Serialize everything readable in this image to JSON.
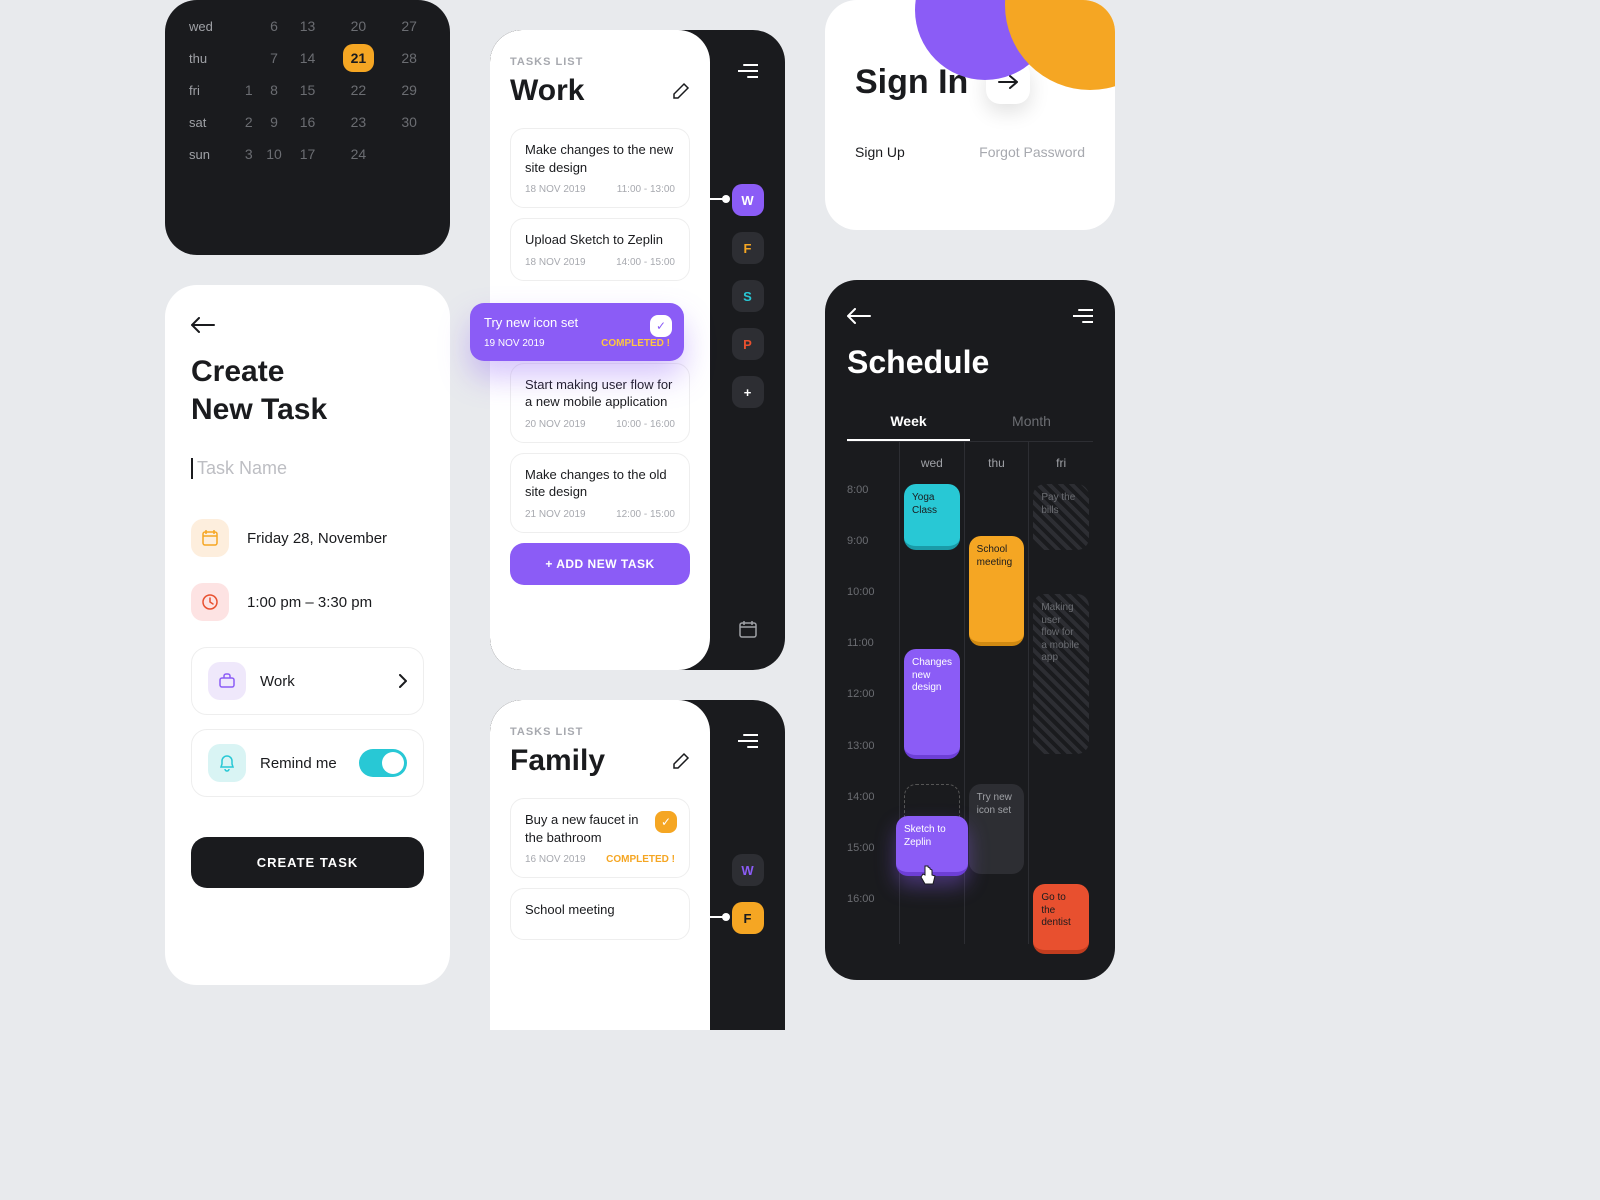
{
  "calendar": {
    "rows": [
      {
        "day": "wed",
        "cells": [
          "6",
          "13",
          "20",
          "27"
        ]
      },
      {
        "day": "thu",
        "cells": [
          "7",
          "14",
          "21",
          "28"
        ],
        "sel": 2
      },
      {
        "day": "fri",
        "cells": [
          "1",
          "8",
          "15",
          "22",
          "29"
        ]
      },
      {
        "day": "sat",
        "cells": [
          "2",
          "9",
          "16",
          "23",
          "30"
        ]
      },
      {
        "day": "sun",
        "cells": [
          "3",
          "10",
          "17",
          "24",
          ""
        ]
      }
    ]
  },
  "create": {
    "title1": "Create",
    "title2": "New Task",
    "placeholder": "Task Name",
    "date": "Friday 28, November",
    "time": "1:00 pm – 3:30 pm",
    "category": "Work",
    "remind": "Remind me",
    "button": "CREATE TASK"
  },
  "tasks1": {
    "label": "TASKS LIST",
    "title": "Work",
    "items": [
      {
        "t": "Make changes to the new site design",
        "d": "18 NOV 2019",
        "h": "11:00 - 13:00"
      },
      {
        "t": "Upload Sketch to Zeplin",
        "d": "18 NOV 2019",
        "h": "14:00 - 15:00"
      },
      {
        "t": "Start making user flow for a new mobile application",
        "d": "20 NOV 2019",
        "h": "10:00 - 16:00"
      },
      {
        "t": "Make changes to the old site design",
        "d": "21 NOV 2019",
        "h": "12:00 - 15:00"
      }
    ],
    "completed": {
      "t": "Try new icon set",
      "d": "19 NOV 2019",
      "status": "COMPLETED !"
    },
    "add": "+ ADD NEW TASK",
    "chips": [
      "W",
      "F",
      "S",
      "P",
      "+"
    ]
  },
  "tasks2": {
    "label": "TASKS LIST",
    "title": "Family",
    "item": {
      "t": "Buy a new faucet in the bathroom",
      "d": "16 NOV 2019",
      "status": "COMPLETED !"
    },
    "item2": "School meeting",
    "chips": [
      "W",
      "F"
    ]
  },
  "signin": {
    "title": "Sign In",
    "signup": "Sign Up",
    "forgot": "Forgot Password"
  },
  "schedule": {
    "title": "Schedule",
    "tabs": [
      "Week",
      "Month"
    ],
    "days": [
      "wed",
      "thu",
      "fri"
    ],
    "times": [
      "8:00",
      "9:00",
      "10:00",
      "11:00",
      "12:00",
      "13:00",
      "14:00",
      "15:00",
      "16:00"
    ],
    "events": {
      "wed": [
        {
          "t": "Yoga Class",
          "cls": "yoga"
        },
        {
          "t": "Changes new design",
          "cls": "chg"
        },
        {
          "t": "",
          "cls": "drag"
        },
        {
          "t": "Sketch to Zeplin",
          "cls": "skz"
        }
      ],
      "thu": [
        {
          "t": "School meeting",
          "cls": "school"
        },
        {
          "t": "Try new icon set",
          "cls": "icon"
        }
      ],
      "fri": [
        {
          "t": "Pay the bills",
          "cls": "bills"
        },
        {
          "t": "Making user flow for a mobile app",
          "cls": "flow"
        },
        {
          "t": "Go to the dentist",
          "cls": "dent"
        }
      ]
    }
  }
}
